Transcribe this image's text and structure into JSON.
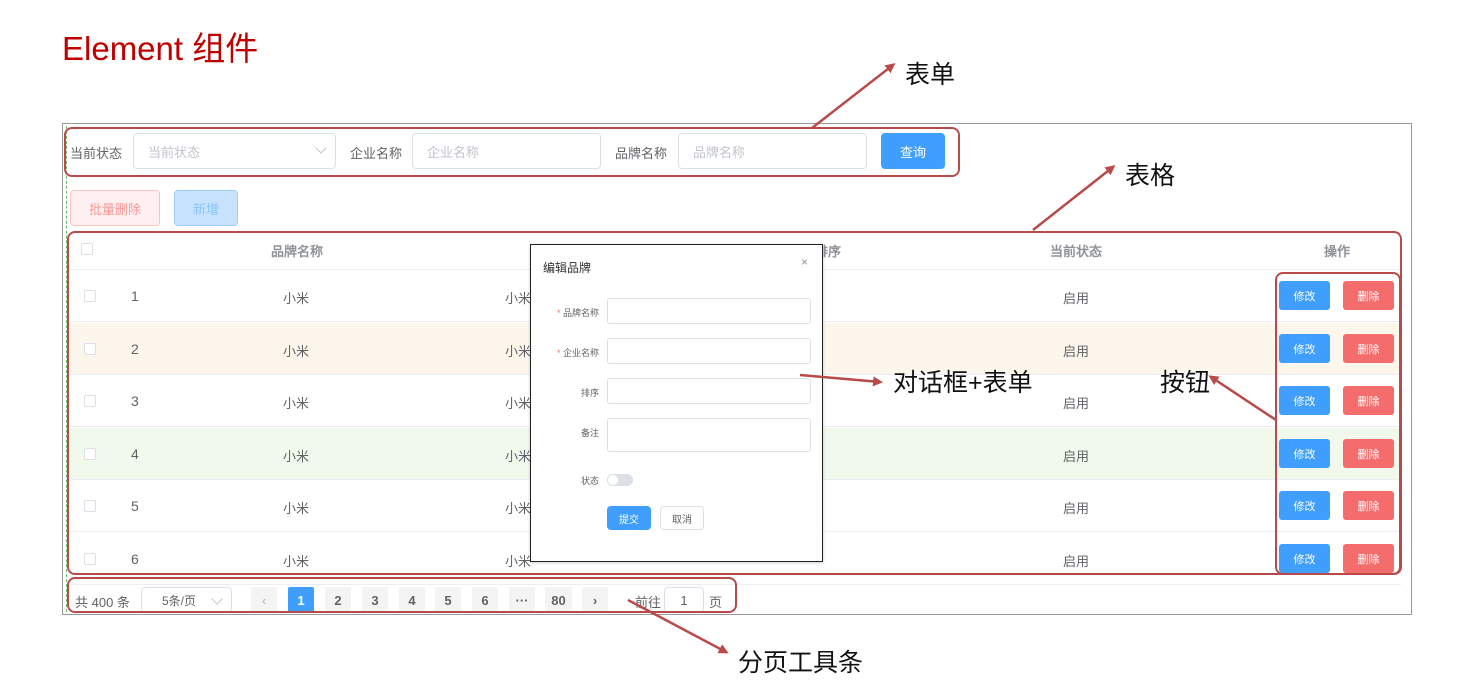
{
  "page_title": "Element 组件",
  "search_form": {
    "status_label": "当前状态",
    "status_placeholder": "当前状态",
    "company_label": "企业名称",
    "company_placeholder": "企业名称",
    "brand_label": "品牌名称",
    "brand_placeholder": "品牌名称",
    "query_button": "查询"
  },
  "toolbar": {
    "batch_delete": "批量删除",
    "add": "新增"
  },
  "table": {
    "headers": {
      "brand_name": "品牌名称",
      "sort": "排序",
      "status": "当前状态",
      "actions": "操作"
    },
    "rows": [
      {
        "index": "1",
        "brand": "小米",
        "company": "小米",
        "status": "启用"
      },
      {
        "index": "2",
        "brand": "小米",
        "company": "小米",
        "status": "启用"
      },
      {
        "index": "3",
        "brand": "小米",
        "company": "小米",
        "status": "启用"
      },
      {
        "index": "4",
        "brand": "小米",
        "company": "小米",
        "status": "启用"
      },
      {
        "index": "5",
        "brand": "小米",
        "company": "小米",
        "status": "启用"
      },
      {
        "index": "6",
        "brand": "小米",
        "company": "小米",
        "status": "启用"
      }
    ],
    "edit_label": "修改",
    "delete_label": "删除",
    "row_colors": [
      "#ffffff",
      "#fdf6ec",
      "#ffffff",
      "#f0f9eb",
      "#ffffff",
      "#ffffff"
    ]
  },
  "dialog": {
    "title": "编辑品牌",
    "close": "×",
    "brand_label": "品牌名称",
    "company_label": "企业名称",
    "sort_label": "排序",
    "remark_label": "备注",
    "status_label": "状态",
    "required_mark": "*",
    "submit": "提交",
    "cancel": "取消"
  },
  "pagination": {
    "total": "共 400 条",
    "page_size": "5条/页",
    "prev": "‹",
    "pages": [
      "1",
      "2",
      "3",
      "4",
      "5",
      "6"
    ],
    "ellipsis": "···",
    "last": "80",
    "next": "›",
    "goto_label": "前往",
    "goto_value": "1",
    "page_unit": "页"
  },
  "annotations": {
    "form": "表单",
    "table": "表格",
    "dialog_form": "对话框+表单",
    "buttons": "按钮",
    "pagination": "分页工具条"
  },
  "colors": {
    "title": "#c00000",
    "primary": "#409eff",
    "danger": "#f56c6c",
    "annotation_box": "#b94a4a"
  }
}
